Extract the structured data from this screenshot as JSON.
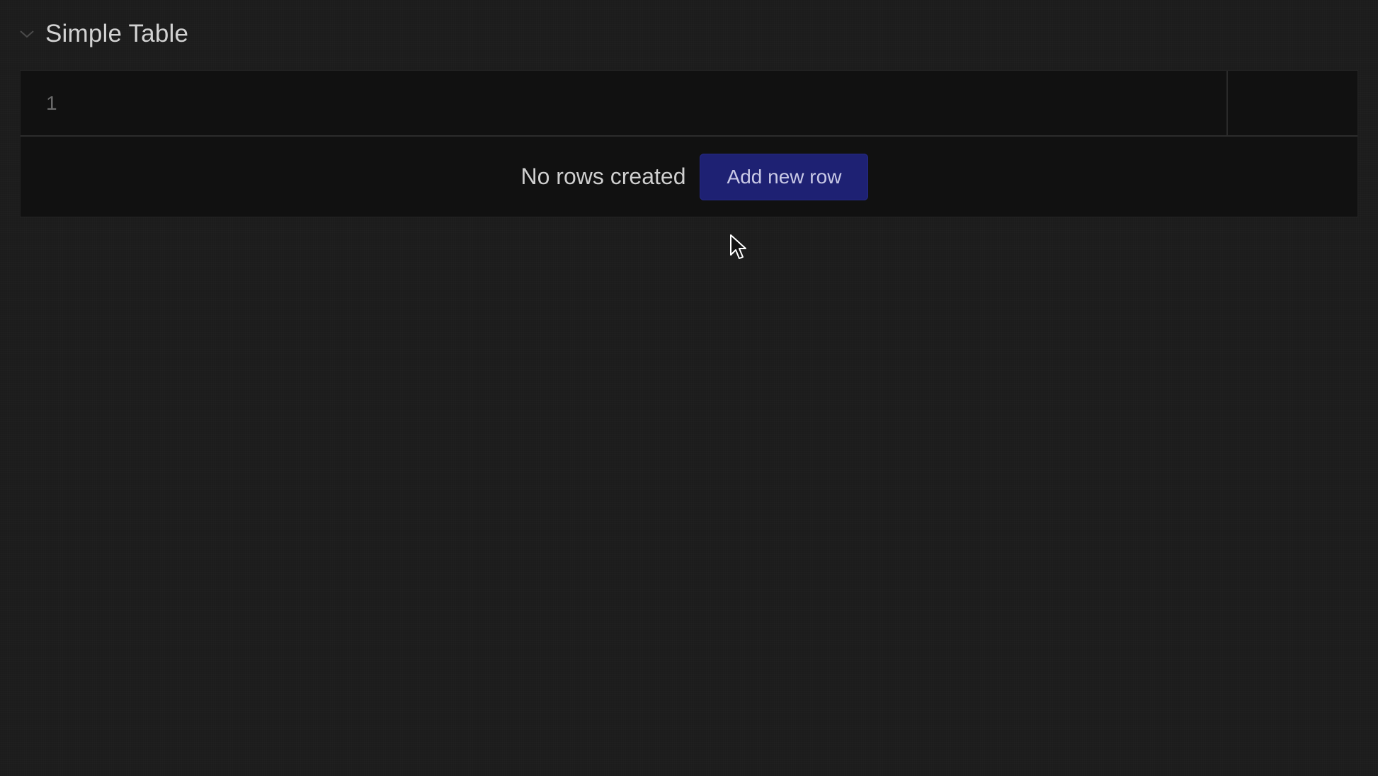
{
  "section": {
    "title": "Simple Table",
    "collapse_icon": "chevron-down-icon"
  },
  "table": {
    "columns": [
      "1"
    ],
    "rows": [],
    "empty_message": "No rows created",
    "add_button_label": "Add new row"
  },
  "colors": {
    "background": "#1c1c1c",
    "table_background": "#111111",
    "button_background": "#1e2173",
    "button_text": "#c9c9e6"
  },
  "cursor_icon": "mouse-pointer-icon"
}
